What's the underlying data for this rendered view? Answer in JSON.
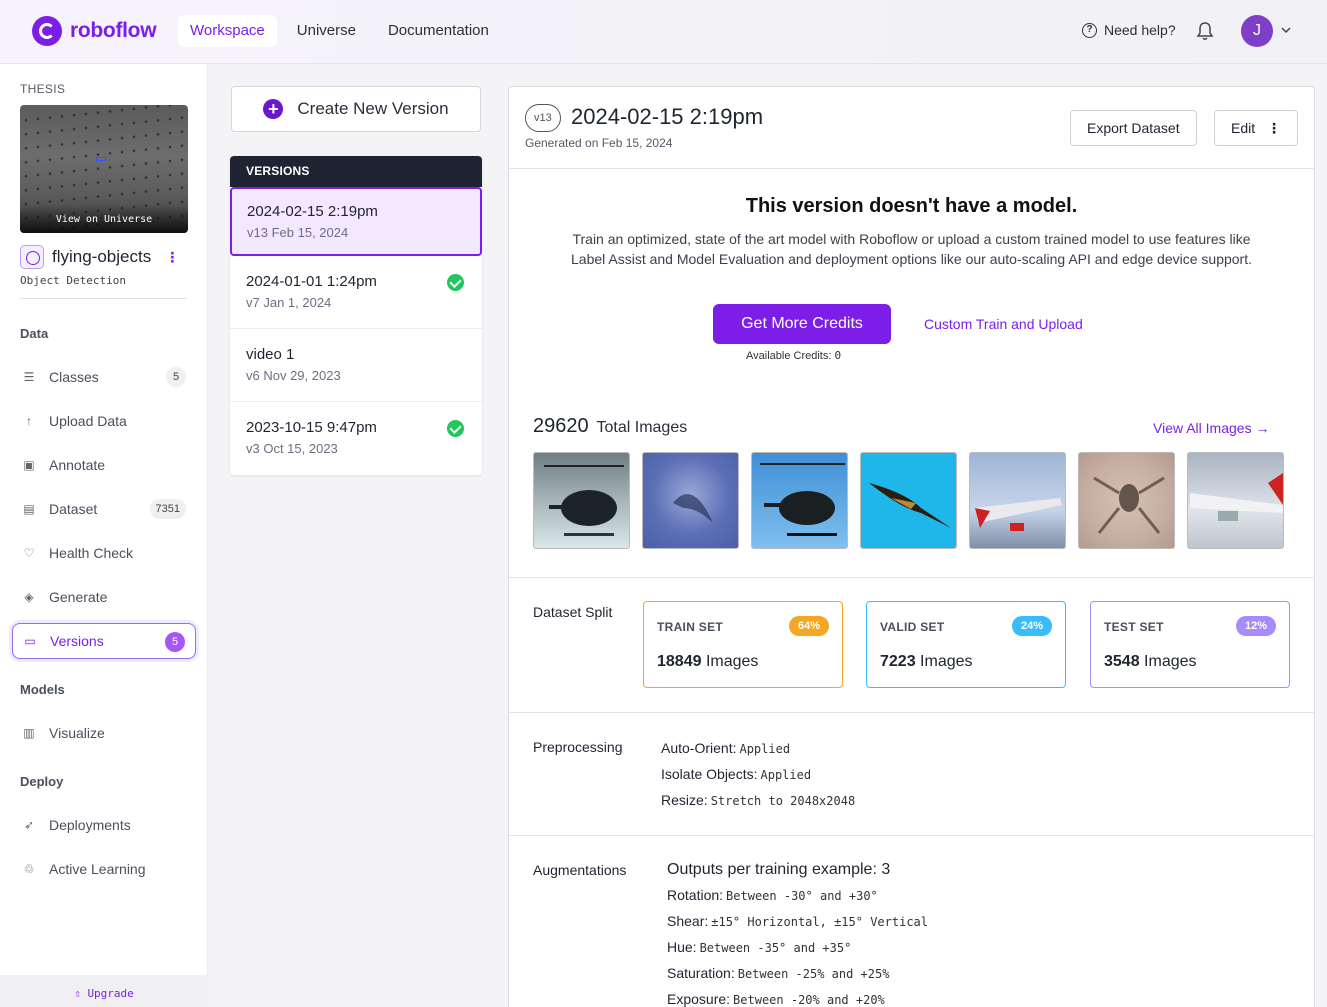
{
  "topbar": {
    "logo": "roboflow",
    "nav": [
      "Workspace",
      "Universe",
      "Documentation"
    ],
    "help": "Need help?",
    "avatar_initial": "J"
  },
  "sidebar": {
    "project_label": "THESIS",
    "thumb_caption": "View on Universe",
    "project_name": "flying-objects",
    "project_type": "Object Detection",
    "sections": {
      "data": "Data",
      "models": "Models",
      "deploy": "Deploy"
    },
    "items": [
      {
        "label": "Classes",
        "badge": "5"
      },
      {
        "label": "Upload Data"
      },
      {
        "label": "Annotate"
      },
      {
        "label": "Dataset",
        "badge": "7351"
      },
      {
        "label": "Health Check"
      },
      {
        "label": "Generate"
      },
      {
        "label": "Versions",
        "badge": "5"
      },
      {
        "label": "Visualize"
      },
      {
        "label": "Deployments"
      },
      {
        "label": "Active Learning"
      }
    ],
    "upgrade": "Upgrade"
  },
  "versions": {
    "create_label": "Create New Version",
    "header": "VERSIONS",
    "list": [
      {
        "title": "2024-02-15 2:19pm",
        "sub": "v13 Feb 15, 2024",
        "trained": false
      },
      {
        "title": "2024-01-01 1:24pm",
        "sub": "v7 Jan 1, 2024",
        "trained": true
      },
      {
        "title": "video 1",
        "sub": "v6 Nov 29, 2023",
        "trained": false
      },
      {
        "title": "2023-10-15 9:47pm",
        "sub": "v3 Oct 15, 2023",
        "trained": true
      }
    ]
  },
  "main": {
    "version_badge": "v13",
    "title": "2024-02-15 2:19pm",
    "generated": "Generated on Feb 15, 2024",
    "export_label": "Export Dataset",
    "edit_label": "Edit",
    "no_model_title": "This version doesn't have a model.",
    "no_model_desc": "Train an optimized, state of the art model with Roboflow or upload a custom trained model to use features like Label Assist and Model Evaluation and deployment options like our auto-scaling API and edge device support.",
    "credits_button": "Get More Credits",
    "custom_link": "Custom Train and Upload",
    "available_credits_label": "Available Credits:",
    "available_credits_value": "0",
    "total_images": "29620",
    "total_images_label": "Total Images",
    "view_all": "View All Images",
    "split_label": "Dataset Split",
    "splits": [
      {
        "name": "TRAIN SET",
        "pct": "64%",
        "count": "18849",
        "unit": "Images",
        "color": "#f5a623"
      },
      {
        "name": "VALID SET",
        "pct": "24%",
        "count": "7223",
        "unit": "Images",
        "color": "#38bdf8"
      },
      {
        "name": "TEST SET",
        "pct": "12%",
        "count": "3548",
        "unit": "Images",
        "color": "#a78bfa"
      }
    ],
    "preprocessing_label": "Preprocessing",
    "preprocessing": [
      {
        "k": "Auto-Orient:",
        "v": "Applied"
      },
      {
        "k": "Isolate Objects:",
        "v": "Applied"
      },
      {
        "k": "Resize:",
        "v": "Stretch to 2048x2048"
      }
    ],
    "augmentations_label": "Augmentations",
    "outputs_line": "Outputs per training example: 3",
    "augmentations": [
      {
        "k": "Rotation:",
        "v": "Between -30° and +30°"
      },
      {
        "k": "Shear:",
        "v": "±15° Horizontal, ±15° Vertical"
      },
      {
        "k": "Hue:",
        "v": "Between -35° and +35°"
      },
      {
        "k": "Saturation:",
        "v": "Between -25% and +25%"
      },
      {
        "k": "Exposure:",
        "v": "Between -20% and +20%"
      }
    ]
  }
}
